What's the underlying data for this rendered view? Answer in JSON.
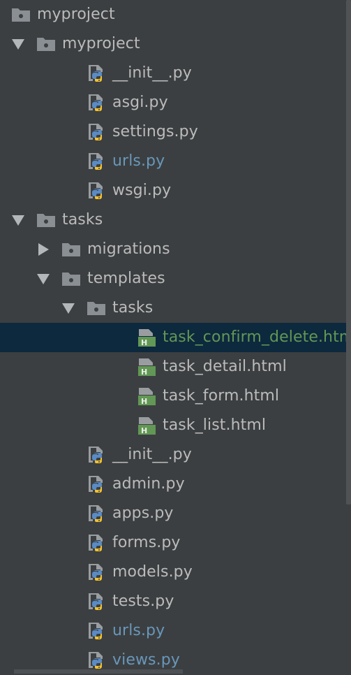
{
  "colors": {
    "background": "#3c3f41",
    "text": "#bbbbbb",
    "vcs_modified": "#6897bb",
    "vcs_new": "#629755",
    "selection": "#0d293e",
    "folder_icon": "#8a8f94",
    "html_icon": "#629755"
  },
  "project_tree": {
    "nodes": [
      {
        "label": "myproject",
        "depth": -1,
        "icon": "folder-icon",
        "arrow": "none",
        "status": "plain"
      },
      {
        "label": "myproject",
        "depth": 0,
        "icon": "folder-icon",
        "arrow": "expanded",
        "status": "plain"
      },
      {
        "label": "__init__.py",
        "depth": 2,
        "icon": "python-file-icon",
        "arrow": "none",
        "status": "plain"
      },
      {
        "label": "asgi.py",
        "depth": 2,
        "icon": "python-file-icon",
        "arrow": "none",
        "status": "plain"
      },
      {
        "label": "settings.py",
        "depth": 2,
        "icon": "python-file-icon",
        "arrow": "none",
        "status": "plain"
      },
      {
        "label": "urls.py",
        "depth": 2,
        "icon": "python-file-icon",
        "arrow": "none",
        "status": "vcs-modified"
      },
      {
        "label": "wsgi.py",
        "depth": 2,
        "icon": "python-file-icon",
        "arrow": "none",
        "status": "plain"
      },
      {
        "label": "tasks",
        "depth": 0,
        "icon": "folder-icon",
        "arrow": "expanded",
        "status": "plain"
      },
      {
        "label": "migrations",
        "depth": 1,
        "icon": "folder-icon",
        "arrow": "collapsed",
        "status": "plain"
      },
      {
        "label": "templates",
        "depth": 1,
        "icon": "folder-icon",
        "arrow": "expanded",
        "status": "plain"
      },
      {
        "label": "tasks",
        "depth": 2,
        "icon": "folder-icon",
        "arrow": "expanded",
        "status": "plain"
      },
      {
        "label": "task_confirm_delete.html",
        "depth": 4,
        "icon": "html-file-icon",
        "arrow": "none",
        "status": "vcs-new",
        "selected": true
      },
      {
        "label": "task_detail.html",
        "depth": 4,
        "icon": "html-file-icon",
        "arrow": "none",
        "status": "plain"
      },
      {
        "label": "task_form.html",
        "depth": 4,
        "icon": "html-file-icon",
        "arrow": "none",
        "status": "plain"
      },
      {
        "label": "task_list.html",
        "depth": 4,
        "icon": "html-file-icon",
        "arrow": "none",
        "status": "plain"
      },
      {
        "label": "__init__.py",
        "depth": 2,
        "icon": "python-file-icon",
        "arrow": "none",
        "status": "plain"
      },
      {
        "label": "admin.py",
        "depth": 2,
        "icon": "python-file-icon",
        "arrow": "none",
        "status": "plain"
      },
      {
        "label": "apps.py",
        "depth": 2,
        "icon": "python-file-icon",
        "arrow": "none",
        "status": "plain"
      },
      {
        "label": "forms.py",
        "depth": 2,
        "icon": "python-file-icon",
        "arrow": "none",
        "status": "plain"
      },
      {
        "label": "models.py",
        "depth": 2,
        "icon": "python-file-icon",
        "arrow": "none",
        "status": "plain"
      },
      {
        "label": "tests.py",
        "depth": 2,
        "icon": "python-file-icon",
        "arrow": "none",
        "status": "plain"
      },
      {
        "label": "urls.py",
        "depth": 2,
        "icon": "python-file-icon",
        "arrow": "none",
        "status": "vcs-modified"
      },
      {
        "label": "views.py",
        "depth": 2,
        "icon": "python-file-icon",
        "arrow": "none",
        "status": "vcs-modified"
      }
    ]
  }
}
